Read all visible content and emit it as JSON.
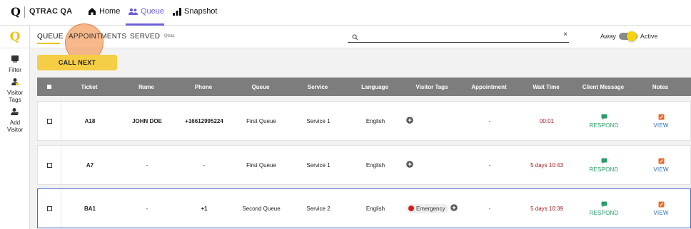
{
  "app": {
    "logo_letter": "Q",
    "brand": "QTRAC QA"
  },
  "nav": {
    "home": "Home",
    "queue": "Queue",
    "snapshot": "Snapshot"
  },
  "sidebar": {
    "logo_letter": "Q",
    "filter": "Filter",
    "visitor_tags_line1": "Visitor",
    "visitor_tags_line2": "Tags",
    "add_visitor_line1": "Add",
    "add_visitor_line2": "Visitor"
  },
  "tabs": {
    "queue": "QUEUE",
    "appointments": "APPOINTMENTS",
    "served": "SERVED",
    "tag": "Qtrac"
  },
  "search": {
    "placeholder": "",
    "value": "",
    "clear": "×"
  },
  "status": {
    "away": "Away",
    "active": "Active",
    "is_active": true
  },
  "call_next": "CALL NEXT",
  "table": {
    "headers": {
      "ticket": "Ticket",
      "name": "Name",
      "phone": "Phone",
      "queue": "Queue",
      "service": "Service",
      "language": "Language",
      "visitor_tags": "Visitor Tags",
      "appointment": "Appointment",
      "wait_time": "Wait Time",
      "client_message": "Client Message",
      "notes": "Notes"
    },
    "rows": [
      {
        "ticket": "A18",
        "name": "JOHN DOE",
        "phone": "+16612995224",
        "queue": "First Queue",
        "service": "Service 1",
        "language": "English",
        "tag": "",
        "appointment": "-",
        "wait": "00:01",
        "respond": "RESPOND",
        "view": "VIEW"
      },
      {
        "ticket": "A7",
        "name": "-",
        "phone": "-",
        "queue": "First Queue",
        "service": "Service 1",
        "language": "English",
        "tag": "",
        "appointment": "-",
        "wait": "5 days 10:43",
        "respond": "RESPOND",
        "view": "VIEW"
      },
      {
        "ticket": "BA1",
        "name": "-",
        "phone": "+1",
        "queue": "Second Queue",
        "service": "Service 2",
        "language": "English",
        "tag": "Emergency",
        "appointment": "-",
        "wait": "5 days 10:39",
        "respond": "RESPOND",
        "view": "VIEW"
      }
    ]
  },
  "colors": {
    "accent_purple": "#6b5fd8",
    "accent_yellow": "#f6ce45",
    "header_gray": "#7d7d7d",
    "wait_red": "#a02020",
    "respond_green": "#2a9d6a",
    "view_blue": "#2f6db8",
    "emergency_red": "#d91a1a"
  },
  "icons": {
    "home": "home-icon",
    "queue": "people-icon",
    "snapshot": "bar-chart-icon",
    "filter": "filter-icon",
    "visitor_tags": "person-tag-icon",
    "add_visitor": "add-person-icon",
    "search": "search-icon",
    "respond": "chat-icon",
    "view": "note-icon",
    "add_tag": "plus-circle-icon"
  }
}
